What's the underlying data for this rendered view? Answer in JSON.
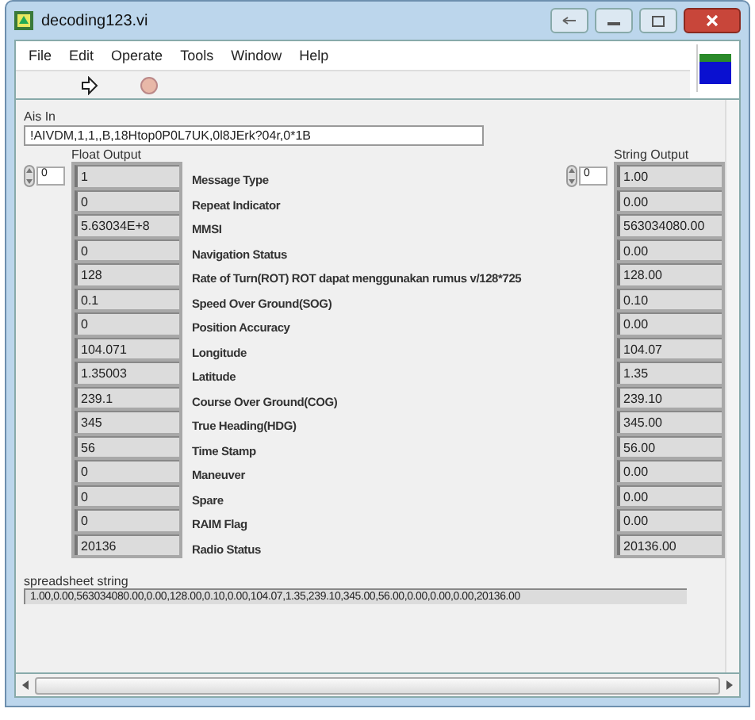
{
  "window": {
    "title": "decoding123.vi"
  },
  "menu": [
    "File",
    "Edit",
    "Operate",
    "Tools",
    "Window",
    "Help"
  ],
  "ais_in": {
    "label": "Ais In",
    "value": "!AIVDM,1,1,,B,18Htop0P0L7UK,0l8JErk?04r,0*1B"
  },
  "float_output": {
    "label": "Float Output",
    "index": "0"
  },
  "string_output": {
    "label": "String Output",
    "index": "0"
  },
  "rows": [
    {
      "float": "1",
      "label": "Message Type",
      "string": "1.00"
    },
    {
      "float": "0",
      "label": "Repeat Indicator",
      "string": "0.00"
    },
    {
      "float": "5.63034E+8",
      "label": "MMSI",
      "string": "563034080.00"
    },
    {
      "float": "0",
      "label": "Navigation Status",
      "string": "0.00"
    },
    {
      "float": "128",
      "label": "Rate of Turn(ROT) ROT dapat menggunakan rumus v/128*725",
      "string": "128.00"
    },
    {
      "float": "0.1",
      "label": "Speed Over Ground(SOG)",
      "string": "0.10"
    },
    {
      "float": "0",
      "label": "Position Accuracy",
      "string": "0.00"
    },
    {
      "float": "104.071",
      "label": "Longitude",
      "string": "104.07"
    },
    {
      "float": "1.35003",
      "label": "Latitude",
      "string": "1.35"
    },
    {
      "float": "239.1",
      "label": "Course Over Ground(COG)",
      "string": "239.10"
    },
    {
      "float": "345",
      "label": "True Heading(HDG)",
      "string": "345.00"
    },
    {
      "float": "56",
      "label": "Time Stamp",
      "string": "56.00"
    },
    {
      "float": "0",
      "label": "Maneuver",
      "string": "0.00"
    },
    {
      "float": "0",
      "label": "Spare",
      "string": "0.00"
    },
    {
      "float": "0",
      "label": "RAIM Flag",
      "string": "0.00"
    },
    {
      "float": "20136",
      "label": "Radio Status",
      "string": "20136.00"
    }
  ],
  "spreadsheet": {
    "label": "spreadsheet string",
    "value": "1.00,0.00,563034080.00,0.00,128.00,0.10,0.00,104.07,1.35,239.10,345.00,56.00,0.00,0.00,0.00,20136.00"
  }
}
